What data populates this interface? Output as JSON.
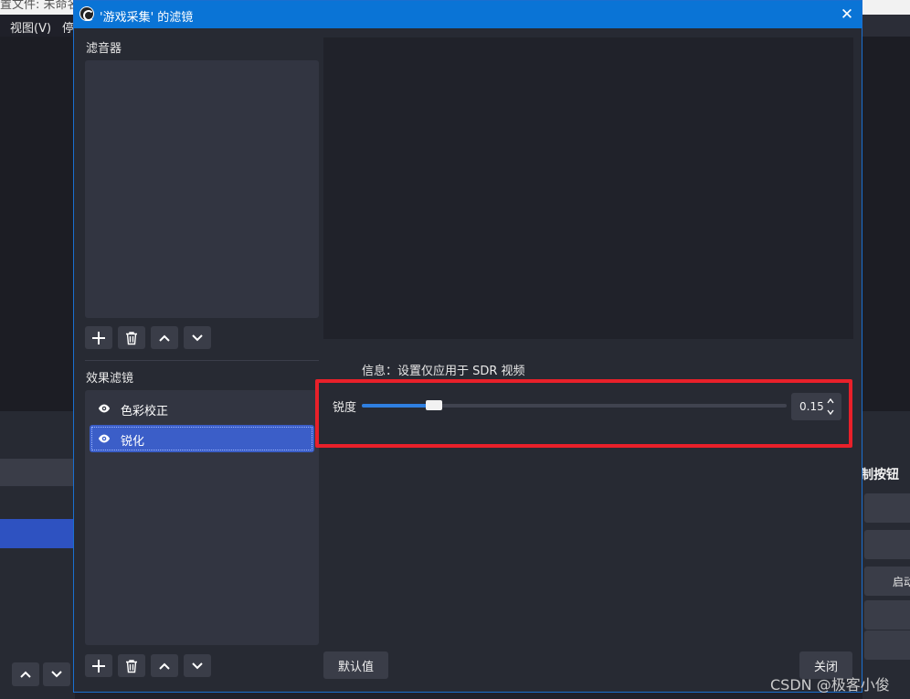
{
  "background_window": {
    "title_partial": "置文件: 未命名",
    "menu": {
      "view": "视图(V)",
      "stop_partial": "停"
    },
    "controls_title_partial": "制按钮",
    "control_label_partial": "启动"
  },
  "dialog": {
    "title": "'游戏采集' 的滤镜",
    "close_glyph": "✕",
    "audio_filters_label": "滤音器",
    "effect_filters_label": "效果滤镜",
    "effect_filters": [
      {
        "name": "色彩校正",
        "visible_icon": "eye-icon",
        "selected": false
      },
      {
        "name": "锐化",
        "visible_icon": "eye-icon",
        "selected": true
      }
    ],
    "info": "信息：设置仅应用于 SDR 视频",
    "property": {
      "label": "锐度",
      "value": "0.15",
      "slider_fraction": 0.17
    },
    "buttons": {
      "defaults": "默认值",
      "close": "关闭"
    }
  },
  "colors": {
    "accent": "#0a74d6",
    "selection": "#3b5ec8",
    "highlight": "#e8202a",
    "slider_fill": "#2f7fe0"
  },
  "watermark": "CSDN @极客小俊"
}
